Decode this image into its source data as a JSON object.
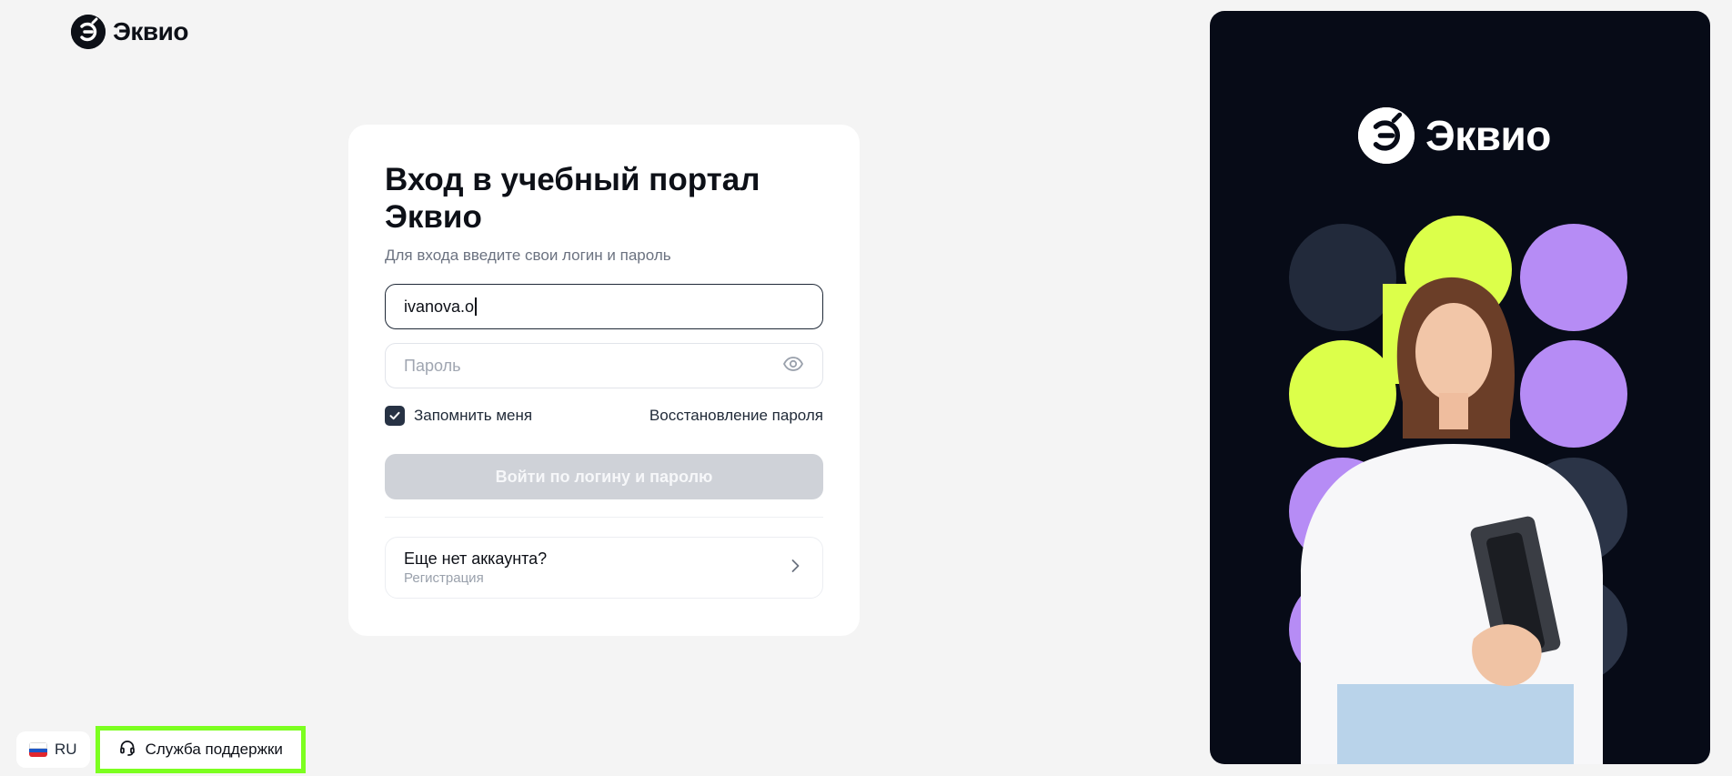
{
  "brand": {
    "name": "Эквио"
  },
  "login_card": {
    "title": "Вход в учебный портал Эквио",
    "subtitle": "Для входа введите свои логин и пароль",
    "login_value": "ivanova.o",
    "password_placeholder": "Пароль",
    "remember_label": "Запомнить меня",
    "remember_checked": true,
    "forgot_label": "Восстановление пароля",
    "submit_label": "Войти по логину и паролю",
    "register_title": "Еще нет аккаунта?",
    "register_subtitle": "Регистрация"
  },
  "footer": {
    "language": "RU",
    "support_label": "Служба поддержки"
  },
  "icons": {
    "eye": "eye-icon",
    "check": "check-icon",
    "chevron": "chevron-right-icon",
    "headset": "headset-icon",
    "flag": "russia-flag-icon"
  },
  "colors": {
    "dark_panel": "#070b17",
    "lime": "#dcff4a",
    "violet": "#b68cf5",
    "slate": "#2b3447",
    "highlight": "#7cff1f"
  }
}
